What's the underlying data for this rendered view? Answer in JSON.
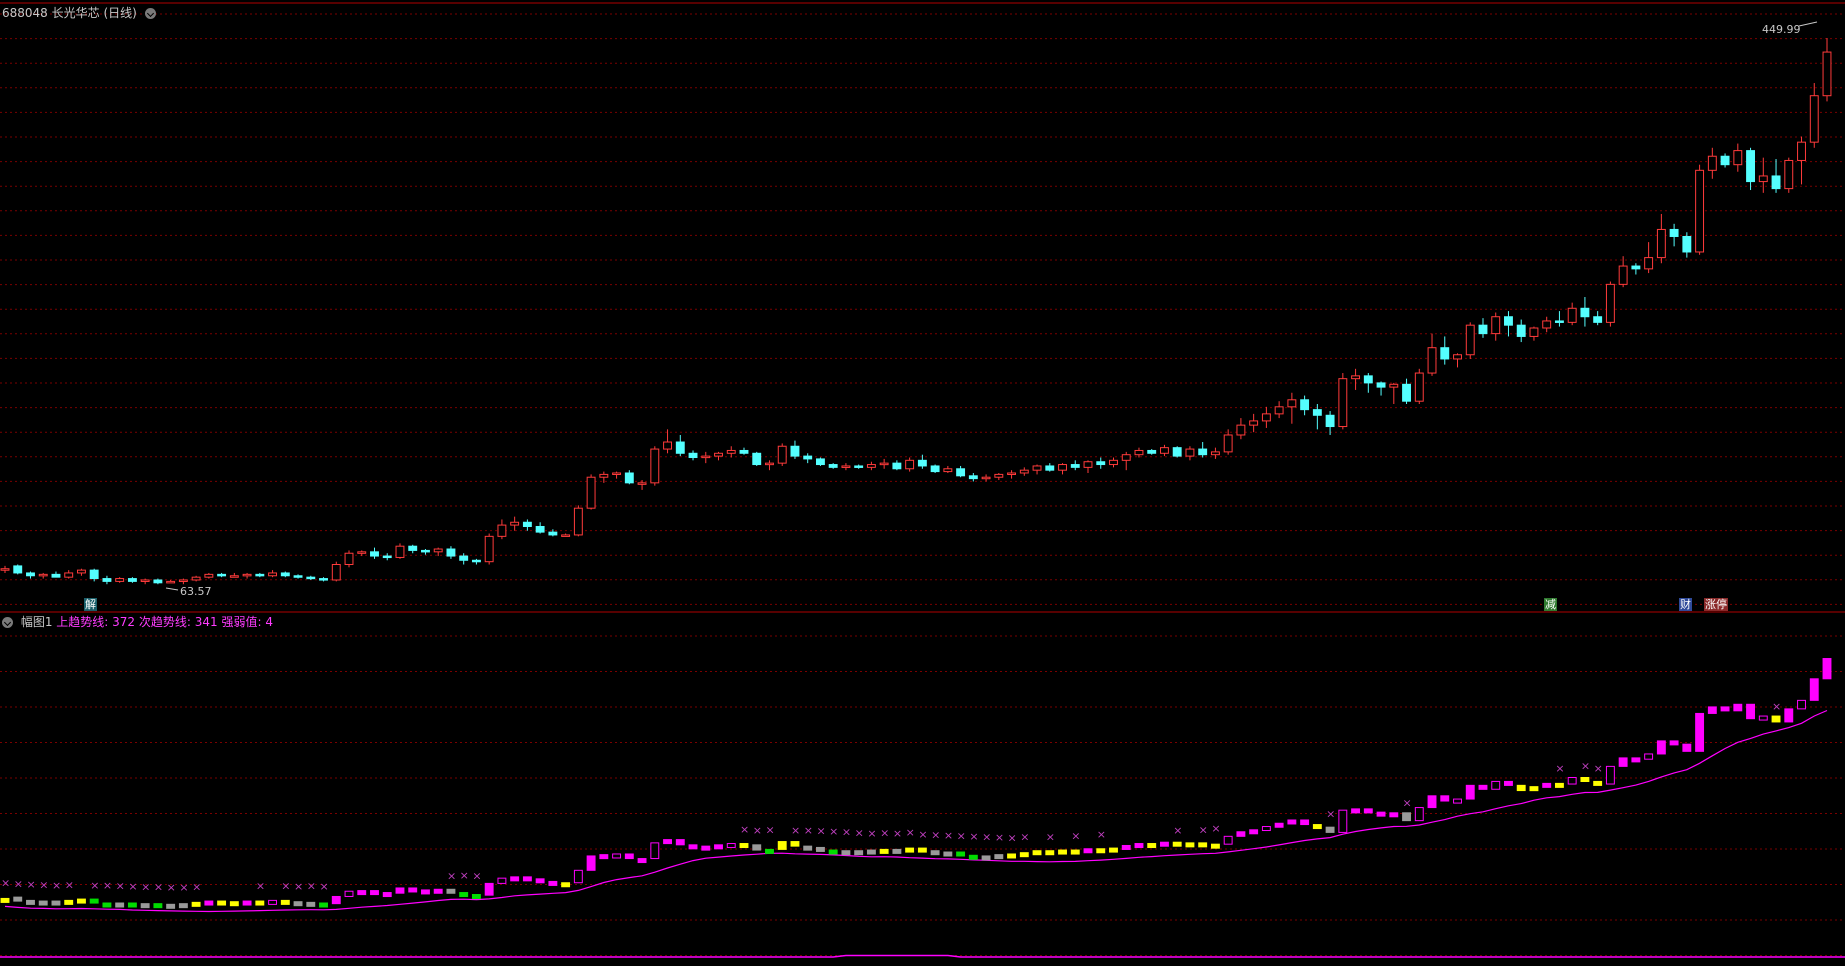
{
  "main_header": {
    "code": "688048",
    "name": "长光华芯",
    "period": "(日线)"
  },
  "sub_header": {
    "title": "幅图1",
    "line1": "上趋势线: 372",
    "line2": "次趋势线: 341",
    "line3": "强弱值: 4"
  },
  "labels": {
    "high_price": "449.99",
    "low_price": "63.57"
  },
  "event_tags": {
    "jie": "解",
    "jian": "减",
    "cai": "财",
    "zhangting": "涨停"
  },
  "colors": {
    "up": "#ff3b3b",
    "down": "#54ffff",
    "grid": "#7a0000",
    "divider": "#b00000",
    "magenta": "#ff00ff",
    "yellow": "#ffff00",
    "green": "#00dd00",
    "gray": "#9a9a9a"
  },
  "chart_data": {
    "type": "candlestick",
    "symbol": "688048",
    "max_price": 449.99,
    "min_price": 63.57,
    "ohlc": [
      [
        72,
        75,
        70,
        73
      ],
      [
        75,
        76,
        69,
        70
      ],
      [
        70,
        71,
        66,
        68
      ],
      [
        68,
        70,
        66,
        69
      ],
      [
        69,
        71,
        67,
        67
      ],
      [
        67,
        72,
        66,
        70
      ],
      [
        70,
        73,
        68,
        72
      ],
      [
        72,
        73,
        64,
        66
      ],
      [
        66,
        68,
        62,
        64
      ],
      [
        64,
        67,
        63,
        66
      ],
      [
        66,
        67,
        63,
        64
      ],
      [
        64,
        66,
        62,
        65
      ],
      [
        65,
        66,
        62,
        63
      ],
      [
        63,
        65,
        63.57,
        64
      ],
      [
        64,
        66,
        62,
        65
      ],
      [
        65,
        68,
        64,
        67
      ],
      [
        67,
        70,
        66,
        69
      ],
      [
        69,
        70,
        67,
        68
      ],
      [
        68,
        70,
        67,
        68
      ],
      [
        68,
        70,
        66,
        69
      ],
      [
        69,
        70,
        67,
        68
      ],
      [
        68,
        72,
        67,
        70
      ],
      [
        70,
        71,
        67,
        68
      ],
      [
        68,
        69,
        66,
        67
      ],
      [
        67,
        68,
        65,
        66
      ],
      [
        66,
        67,
        64,
        65
      ],
      [
        65,
        78,
        64,
        76
      ],
      [
        76,
        86,
        74,
        84
      ],
      [
        84,
        86,
        82,
        85
      ],
      [
        85,
        88,
        80,
        82
      ],
      [
        82,
        84,
        79,
        81
      ],
      [
        81,
        91,
        80,
        89
      ],
      [
        89,
        90,
        84,
        86
      ],
      [
        86,
        87,
        83,
        85
      ],
      [
        85,
        88,
        82,
        87
      ],
      [
        87,
        89,
        80,
        82
      ],
      [
        82,
        84,
        76,
        79
      ],
      [
        79,
        80,
        76,
        78
      ],
      [
        78,
        98,
        76,
        96
      ],
      [
        96,
        108,
        94,
        104
      ],
      [
        104,
        110,
        100,
        106
      ],
      [
        106,
        108,
        100,
        103
      ],
      [
        103,
        106,
        98,
        99
      ],
      [
        99,
        101,
        96,
        97
      ],
      [
        97,
        98,
        96,
        97
      ],
      [
        97,
        118,
        96,
        116
      ],
      [
        116,
        140,
        115,
        138
      ],
      [
        138,
        142,
        134,
        140
      ],
      [
        140,
        142,
        137,
        141
      ],
      [
        141,
        143,
        133,
        134
      ],
      [
        134,
        136,
        129,
        134
      ],
      [
        134,
        160,
        132,
        158
      ],
      [
        158,
        172,
        155,
        163
      ],
      [
        163,
        168,
        153,
        155
      ],
      [
        155,
        157,
        150,
        152
      ],
      [
        152,
        156,
        148,
        153
      ],
      [
        153,
        156,
        150,
        155
      ],
      [
        155,
        160,
        152,
        157
      ],
      [
        157,
        159,
        154,
        155
      ],
      [
        155,
        156,
        146,
        147
      ],
      [
        147,
        150,
        143,
        148
      ],
      [
        148,
        162,
        146,
        160
      ],
      [
        160,
        164,
        151,
        153
      ],
      [
        153,
        155,
        148,
        151
      ],
      [
        151,
        152,
        146,
        147
      ],
      [
        147,
        148,
        144,
        145
      ],
      [
        145,
        148,
        143,
        146
      ],
      [
        146,
        147,
        144,
        145
      ],
      [
        145,
        149,
        143,
        147
      ],
      [
        147,
        151,
        144,
        148
      ],
      [
        148,
        150,
        143,
        144
      ],
      [
        144,
        152,
        142,
        150
      ],
      [
        150,
        154,
        144,
        146
      ],
      [
        146,
        147,
        141,
        142
      ],
      [
        142,
        146,
        141,
        144
      ],
      [
        144,
        146,
        138,
        139
      ],
      [
        139,
        141,
        135,
        137
      ],
      [
        137,
        140,
        135,
        138
      ],
      [
        138,
        141,
        136,
        140
      ],
      [
        140,
        143,
        137,
        141
      ],
      [
        141,
        145,
        139,
        143
      ],
      [
        143,
        147,
        140,
        146
      ],
      [
        146,
        148,
        142,
        143
      ],
      [
        143,
        148,
        140,
        147
      ],
      [
        147,
        150,
        143,
        145
      ],
      [
        145,
        150,
        141,
        149
      ],
      [
        149,
        152,
        144,
        147
      ],
      [
        147,
        152,
        145,
        150
      ],
      [
        150,
        156,
        143,
        154
      ],
      [
        154,
        159,
        152,
        157
      ],
      [
        157,
        158,
        154,
        155
      ],
      [
        155,
        161,
        153,
        159
      ],
      [
        159,
        160,
        152,
        153
      ],
      [
        153,
        160,
        150,
        158
      ],
      [
        158,
        163,
        152,
        154
      ],
      [
        154,
        159,
        151,
        156
      ],
      [
        156,
        172,
        154,
        168
      ],
      [
        168,
        180,
        165,
        175
      ],
      [
        175,
        183,
        170,
        178
      ],
      [
        178,
        188,
        173,
        183
      ],
      [
        183,
        192,
        180,
        188
      ],
      [
        188,
        198,
        176,
        193
      ],
      [
        193,
        196,
        182,
        186
      ],
      [
        186,
        190,
        172,
        182
      ],
      [
        182,
        185,
        168,
        174
      ],
      [
        174,
        212,
        172,
        208
      ],
      [
        208,
        215,
        200,
        210
      ],
      [
        210,
        212,
        198,
        205
      ],
      [
        205,
        206,
        196,
        202
      ],
      [
        202,
        205,
        190,
        204
      ],
      [
        204,
        208,
        190,
        192
      ],
      [
        192,
        215,
        190,
        212
      ],
      [
        212,
        240,
        210,
        230
      ],
      [
        230,
        238,
        218,
        222
      ],
      [
        222,
        226,
        216,
        225
      ],
      [
        225,
        248,
        222,
        246
      ],
      [
        246,
        251,
        237,
        240
      ],
      [
        240,
        255,
        235,
        252
      ],
      [
        252,
        256,
        238,
        246
      ],
      [
        246,
        250,
        234,
        238
      ],
      [
        238,
        245,
        235,
        244
      ],
      [
        244,
        252,
        241,
        249
      ],
      [
        249,
        256,
        245,
        248
      ],
      [
        248,
        262,
        246,
        258
      ],
      [
        258,
        266,
        245,
        252
      ],
      [
        252,
        256,
        246,
        248
      ],
      [
        248,
        277,
        245,
        275
      ],
      [
        275,
        295,
        273,
        288
      ],
      [
        288,
        290,
        282,
        286
      ],
      [
        286,
        305,
        283,
        294
      ],
      [
        294,
        325,
        290,
        314
      ],
      [
        314,
        318,
        302,
        309
      ],
      [
        309,
        312,
        294,
        298
      ],
      [
        298,
        360,
        296,
        356
      ],
      [
        356,
        372,
        350,
        366
      ],
      [
        366,
        368,
        358,
        360
      ],
      [
        360,
        375,
        355,
        370
      ],
      [
        370,
        372,
        342,
        348
      ],
      [
        348,
        365,
        340,
        352
      ],
      [
        352,
        364,
        340,
        343
      ],
      [
        343,
        365,
        340,
        363
      ],
      [
        363,
        380,
        346,
        376
      ],
      [
        376,
        418,
        372,
        409
      ],
      [
        409,
        449.99,
        405,
        440
      ]
    ]
  }
}
